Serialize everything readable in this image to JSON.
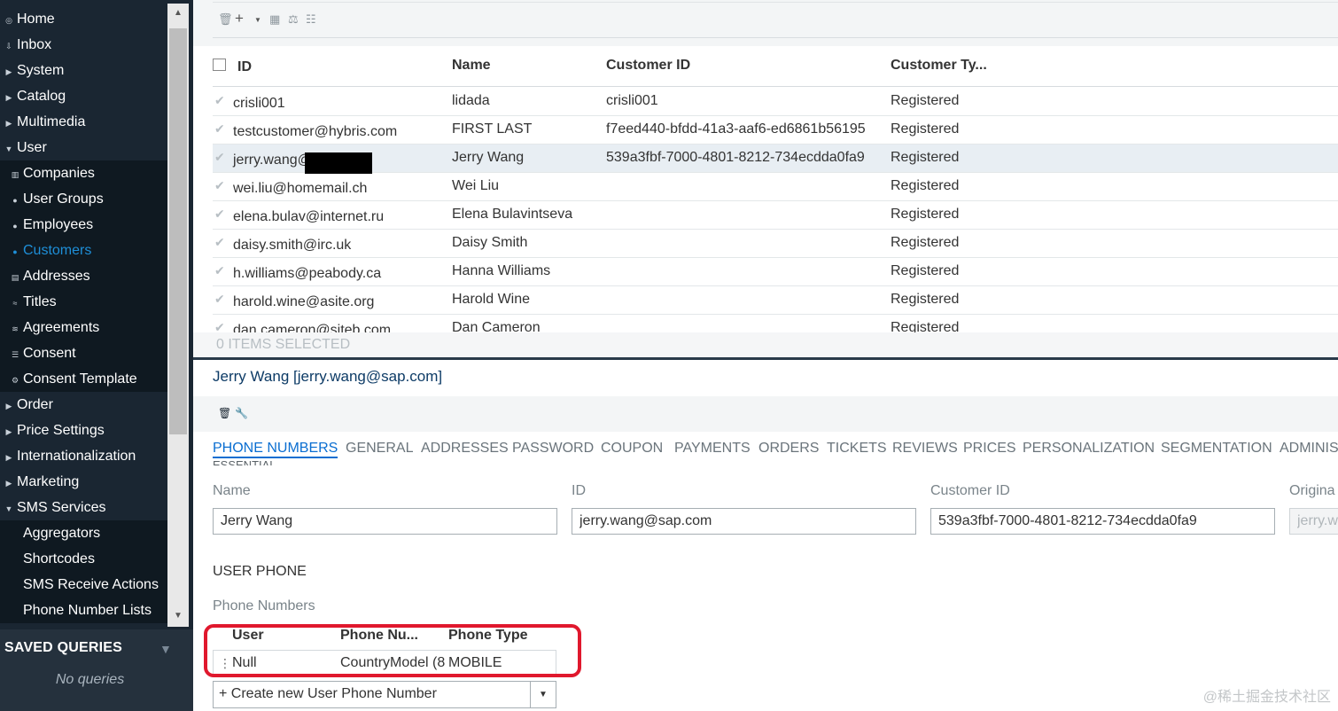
{
  "sidebar": {
    "items": [
      {
        "label": "Home",
        "icon": "home-icon",
        "glyph": "◎",
        "type": "top"
      },
      {
        "label": "Inbox",
        "icon": "inbox-icon",
        "glyph": "⇩",
        "type": "top"
      },
      {
        "label": "System",
        "icon": "caret-right-icon",
        "glyph": "▶",
        "type": "top"
      },
      {
        "label": "Catalog",
        "icon": "caret-right-icon",
        "glyph": "▶",
        "type": "top"
      },
      {
        "label": "Multimedia",
        "icon": "caret-right-icon",
        "glyph": "▶",
        "type": "top"
      },
      {
        "label": "User",
        "icon": "caret-down-icon",
        "glyph": "▼",
        "type": "top"
      },
      {
        "label": "Companies",
        "icon": "company-icon",
        "glyph": "▥",
        "type": "sub"
      },
      {
        "label": "User Groups",
        "icon": "user-groups-icon",
        "glyph": "●",
        "type": "sub"
      },
      {
        "label": "Employees",
        "icon": "employees-icon",
        "glyph": "●",
        "type": "sub"
      },
      {
        "label": "Customers",
        "icon": "customers-icon",
        "glyph": "●",
        "type": "sub",
        "active": true
      },
      {
        "label": "Addresses",
        "icon": "addresses-icon",
        "glyph": "▤",
        "type": "sub"
      },
      {
        "label": "Titles",
        "icon": "titles-icon",
        "glyph": "≈",
        "type": "sub"
      },
      {
        "label": "Agreements",
        "icon": "agreements-icon",
        "glyph": "≋",
        "type": "sub"
      },
      {
        "label": "Consent",
        "icon": "consent-icon",
        "glyph": "☰",
        "type": "sub"
      },
      {
        "label": "Consent Template",
        "icon": "consent-template-icon",
        "glyph": "⚙",
        "type": "sub"
      },
      {
        "label": "Order",
        "icon": "caret-right-icon",
        "glyph": "▶",
        "type": "top"
      },
      {
        "label": "Price Settings",
        "icon": "caret-right-icon",
        "glyph": "▶",
        "type": "top"
      },
      {
        "label": "Internationalization",
        "icon": "caret-right-icon",
        "glyph": "▶",
        "type": "top"
      },
      {
        "label": "Marketing",
        "icon": "caret-right-icon",
        "glyph": "▶",
        "type": "top"
      },
      {
        "label": "SMS Services",
        "icon": "caret-down-icon",
        "glyph": "▼",
        "type": "top"
      },
      {
        "label": "Aggregators",
        "icon": "",
        "glyph": "",
        "type": "sub"
      },
      {
        "label": "Shortcodes",
        "icon": "",
        "glyph": "",
        "type": "sub"
      },
      {
        "label": "SMS Receive Actions",
        "icon": "",
        "glyph": "",
        "type": "sub"
      },
      {
        "label": "Phone Number Lists",
        "icon": "",
        "glyph": "",
        "type": "sub"
      }
    ],
    "saved_queries": {
      "title": "SAVED QUERIES",
      "empty": "No queries"
    }
  },
  "grid": {
    "columns": [
      "ID",
      "Name",
      "Customer ID",
      "Customer Ty..."
    ],
    "rows": [
      {
        "id": "crisli001",
        "name": "lidada",
        "customer_id": "crisli001",
        "type": "Registered"
      },
      {
        "id": "testcustomer@hybris.com",
        "name": "FIRST LAST",
        "customer_id": "f7eed440-bfdd-41a3-aaf6-ed6861b56195",
        "type": "Registered"
      },
      {
        "id": "jerry.wang@",
        "name": "Jerry Wang",
        "customer_id": "539a3fbf-7000-4801-8212-734ecdda0fa9",
        "type": "Registered",
        "selected": true
      },
      {
        "id": "wei.liu@homemail.ch",
        "name": "Wei Liu",
        "customer_id": "",
        "type": "Registered"
      },
      {
        "id": "elena.bulav@internet.ru",
        "name": "Elena Bulavintseva",
        "customer_id": "",
        "type": "Registered"
      },
      {
        "id": "daisy.smith@irc.uk",
        "name": "Daisy Smith",
        "customer_id": "",
        "type": "Registered"
      },
      {
        "id": "h.williams@peabody.ca",
        "name": "Hanna Williams",
        "customer_id": "",
        "type": "Registered"
      },
      {
        "id": "harold.wine@asite.org",
        "name": "Harold Wine",
        "customer_id": "",
        "type": "Registered"
      },
      {
        "id": "dan.cameron@siteb.com",
        "name": "Dan Cameron",
        "customer_id": "",
        "type": "Registered"
      }
    ],
    "selected_count": "0 ITEMS SELECTED"
  },
  "detail": {
    "title": "Jerry Wang [jerry.wang@sap.com]",
    "tabs": [
      "PHONE NUMBERS",
      "GENERAL",
      "ADDRESSES",
      "PASSWORD",
      "COUPON",
      "PAYMENTS",
      "ORDERS",
      "TICKETS",
      "REVIEWS",
      "PRICES",
      "PERSONALIZATION",
      "SEGMENTATION",
      "ADMINIS"
    ],
    "section_cut": "ESSENTIAL",
    "fields": {
      "name_label": "Name",
      "name_value": "Jerry Wang",
      "id_label": "ID",
      "id_value": "jerry.wang@sap.com",
      "customer_id_label": "Customer ID",
      "customer_id_value": "539a3fbf-7000-4801-8212-734ecdda0fa9",
      "original_label": "Origina",
      "original_value": "jerry.w"
    },
    "user_phone_title": "USER PHONE",
    "phone_numbers_label": "Phone Numbers",
    "phone_table": {
      "headers": [
        "User",
        "Phone Nu...",
        "Phone Type"
      ],
      "row": {
        "user": "Null",
        "phone": "CountryModel (8",
        "type": "MOBILE"
      }
    },
    "create_label": "+ Create new User Phone Number"
  },
  "watermark": "@稀土掘金技术社区",
  "colors": {
    "sidebar_bg": "#1a2632",
    "accent": "#0a6ed1",
    "active_nav": "#1e8fd8",
    "highlight": "#e0182d"
  }
}
